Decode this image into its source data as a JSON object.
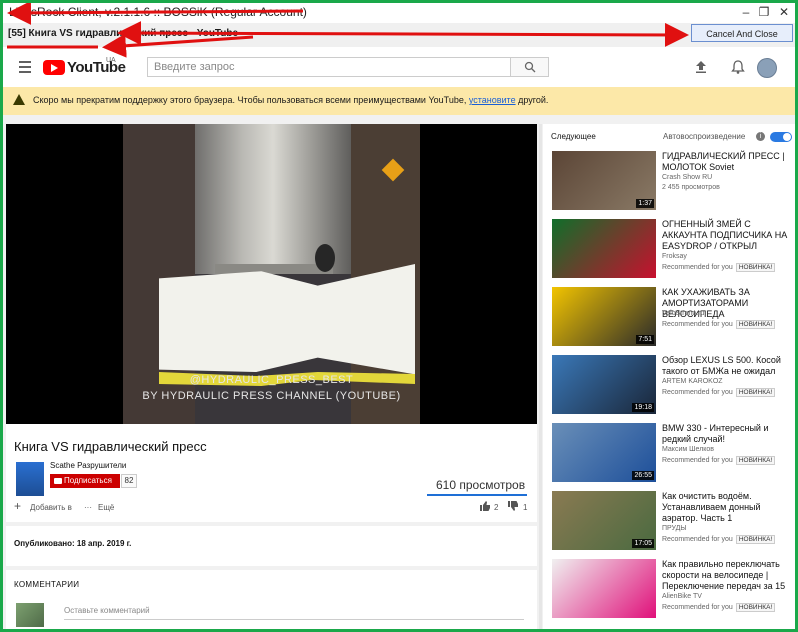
{
  "window": {
    "title": "LikesRock Client, v.2.1.1.6 :: BOSSiK (Regular Account)",
    "controls": [
      "–",
      "❐",
      "✕"
    ],
    "caption": "[55]  Книга VS гидравлический пресс - YouTube",
    "cancel_label": "Cancel And Close"
  },
  "header": {
    "logo_text": "YouTube",
    "region": "UA",
    "search_placeholder": "Введите запрос"
  },
  "warning": {
    "text_before": "Скоро мы прекратим поддержку этого браузера. Чтобы пользоваться всеми преимуществами YouTube, ",
    "link": "установите",
    "text_after": " другой."
  },
  "video": {
    "watermark_line1": "@HYDRAULIC_PRESS_BEST",
    "watermark_line2": "BY HYDRAULIC PRESS CHANNEL (YOUTUBE)",
    "title": "Книга VS гидравлический пресс",
    "channel": "Scathe Разрушители",
    "subscribe_label": "Подписаться",
    "subscriber_count": "82",
    "views": "610 просмотров",
    "add_label": "Добавить в",
    "more_label": "Ещё",
    "likes": "2",
    "dislikes": "1",
    "published": "Опубликовано: 18 апр. 2019 г."
  },
  "comments": {
    "title": "КОММЕНТАРИИ",
    "placeholder": "Оставьте комментарий"
  },
  "sidebar": {
    "heading": "Следующее",
    "autoplay_label": "Автовоспроизведение",
    "recommendations": [
      {
        "title": "ГИДРАВЛИЧЕСКИЙ ПРЕСС | МОЛОТОК Soviet",
        "channel": "Crash Show RU",
        "meta": "2 455 просмотров",
        "badge": "",
        "duration": "1:37",
        "color_a": "#5b4536",
        "color_b": "#8a7a66"
      },
      {
        "title": "ОГНЕННЫЙ ЗМЕЙ С АККАУНТА ПОДПИСЧИКА НА EASYDROP / ОТКРЫЛ",
        "channel": "Froksay",
        "meta": "Recommended for you",
        "badge": "НОВИНКА!",
        "duration": "",
        "color_a": "#0f6e2a",
        "color_b": "#c8102e"
      },
      {
        "title": "КАК УХАЖИВАТЬ ЗА АМОРТИЗАТОРАМИ ВЕЛОСИПЕДА",
        "channel": "VeloStrana.ru",
        "meta": "Recommended for you",
        "badge": "НОВИНКА!",
        "duration": "7:51",
        "color_a": "#f2c400",
        "color_b": "#2a2a2a"
      },
      {
        "title": "Обзор LEXUS LS 500. Косой такого от БМЖа не ожидал",
        "channel": "ARTEM KAROKOZ",
        "meta": "Recommended for you",
        "badge": "НОВИНКА!",
        "duration": "19:18",
        "color_a": "#3a78b8",
        "color_b": "#1a2638"
      },
      {
        "title": "BMW 330 - Интересный и редкий случай!",
        "channel": "Максим Шелков",
        "meta": "Recommended for you",
        "badge": "НОВИНКА!",
        "duration": "26:55",
        "color_a": "#6a8fb8",
        "color_b": "#1d4f9a"
      },
      {
        "title": "Как очистить водоём. Устанавливаем донный аэратор. Часть 1",
        "channel": "ПРУДЫ",
        "meta": "Recommended for you",
        "badge": "НОВИНКА!",
        "duration": "17:05",
        "color_a": "#8a7a52",
        "color_b": "#4a6a40"
      },
      {
        "title": "Как правильно переключать скорости на велосипеде | Переключение передач за 15",
        "channel": "AlienBike TV",
        "meta": "Recommended for you",
        "badge": "НОВИНКА!",
        "duration": "",
        "color_a": "#f0f0f0",
        "color_b": "#e0107a"
      }
    ]
  }
}
